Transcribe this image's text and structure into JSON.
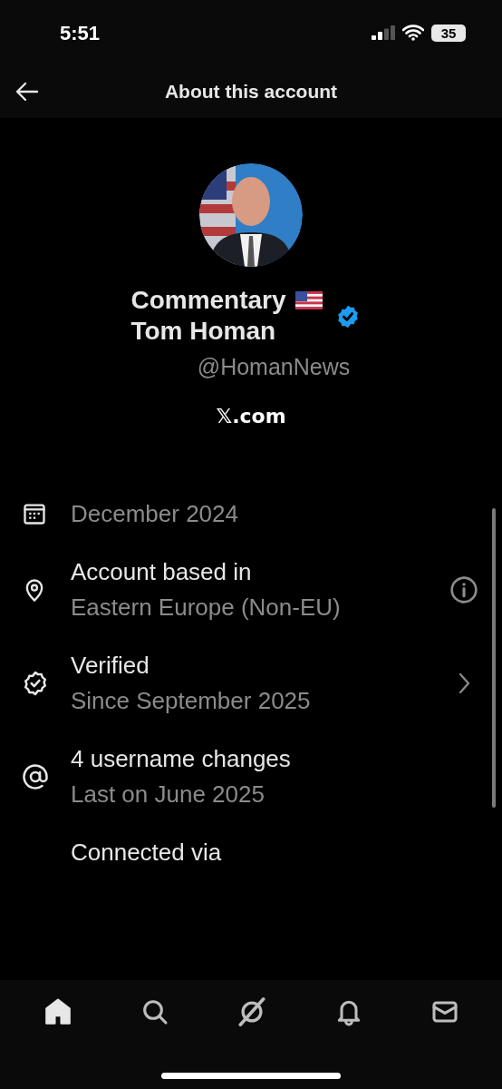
{
  "status_bar": {
    "time": "5:51",
    "battery": "35"
  },
  "header": {
    "title": "About this account"
  },
  "profile": {
    "name_lines": [
      "Commentary",
      "Tom Homan"
    ],
    "verified": true,
    "handle": "@HomanNews",
    "site": "𝕏.com"
  },
  "details": [
    {
      "kind": "date",
      "subtitle": "December 2024"
    },
    {
      "kind": "location",
      "title": "Account based in",
      "subtitle": "Eastern Europe (Non-EU)",
      "info_button": true
    },
    {
      "kind": "verified",
      "title": "Verified",
      "subtitle": "Since September 2025",
      "chevron": true
    },
    {
      "kind": "username",
      "title": "4 username changes",
      "subtitle": "Last on June 2025"
    },
    {
      "kind": "connected",
      "title": "Connected via"
    }
  ],
  "tab_bar": [
    {
      "kind": "home",
      "selected": true
    },
    {
      "kind": "search",
      "selected": false
    },
    {
      "kind": "grok",
      "selected": false
    },
    {
      "kind": "notifications",
      "selected": false
    },
    {
      "kind": "messages",
      "selected": false
    }
  ]
}
